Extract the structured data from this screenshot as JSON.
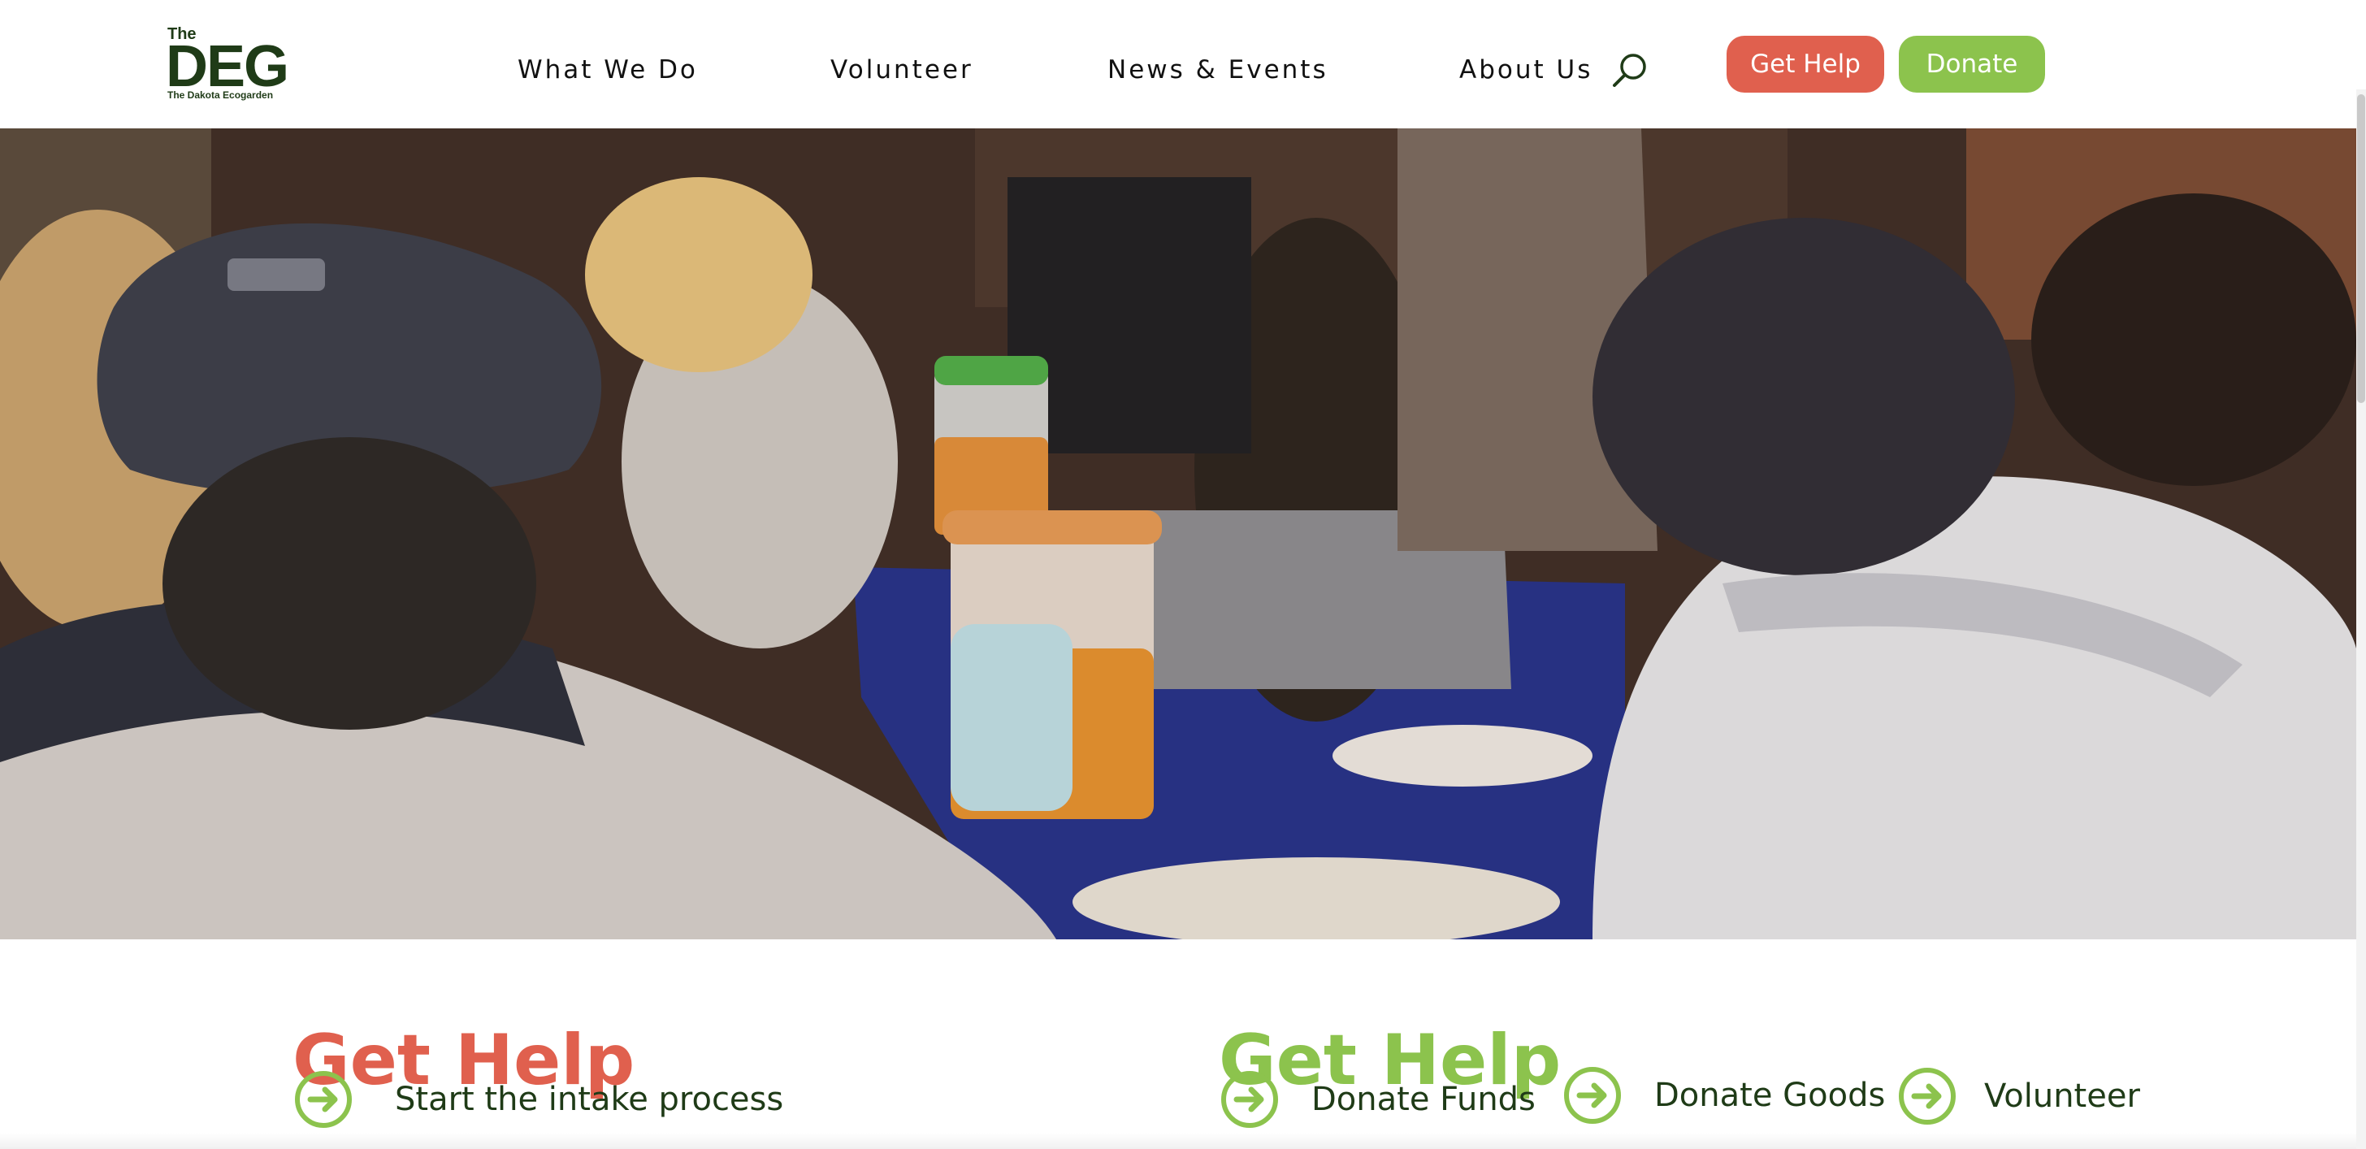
{
  "logo": {
    "the": "The",
    "mark": "DEG",
    "subtitle": "The Dakota Ecogarden"
  },
  "nav": {
    "items": [
      "What We Do",
      "Volunteer",
      "News & Events",
      "About Us"
    ]
  },
  "header_buttons": {
    "get_help": "Get Help",
    "donate": "Donate"
  },
  "icons": {
    "search": "search-icon",
    "arrow": "arrow-right-circle-icon"
  },
  "colors": {
    "brand_dark_green": "#1f3b17",
    "get_help_red": "#e0604e",
    "donate_green": "#8cc34d"
  },
  "hero": {
    "image": "people-sharing-meal-photo"
  },
  "sections": {
    "left": {
      "title": "Get Help",
      "links": [
        "Start the intake process"
      ]
    },
    "right": {
      "title": "Get Help",
      "links": [
        "Donate Funds",
        "Donate Goods",
        "Volunteer"
      ]
    }
  }
}
